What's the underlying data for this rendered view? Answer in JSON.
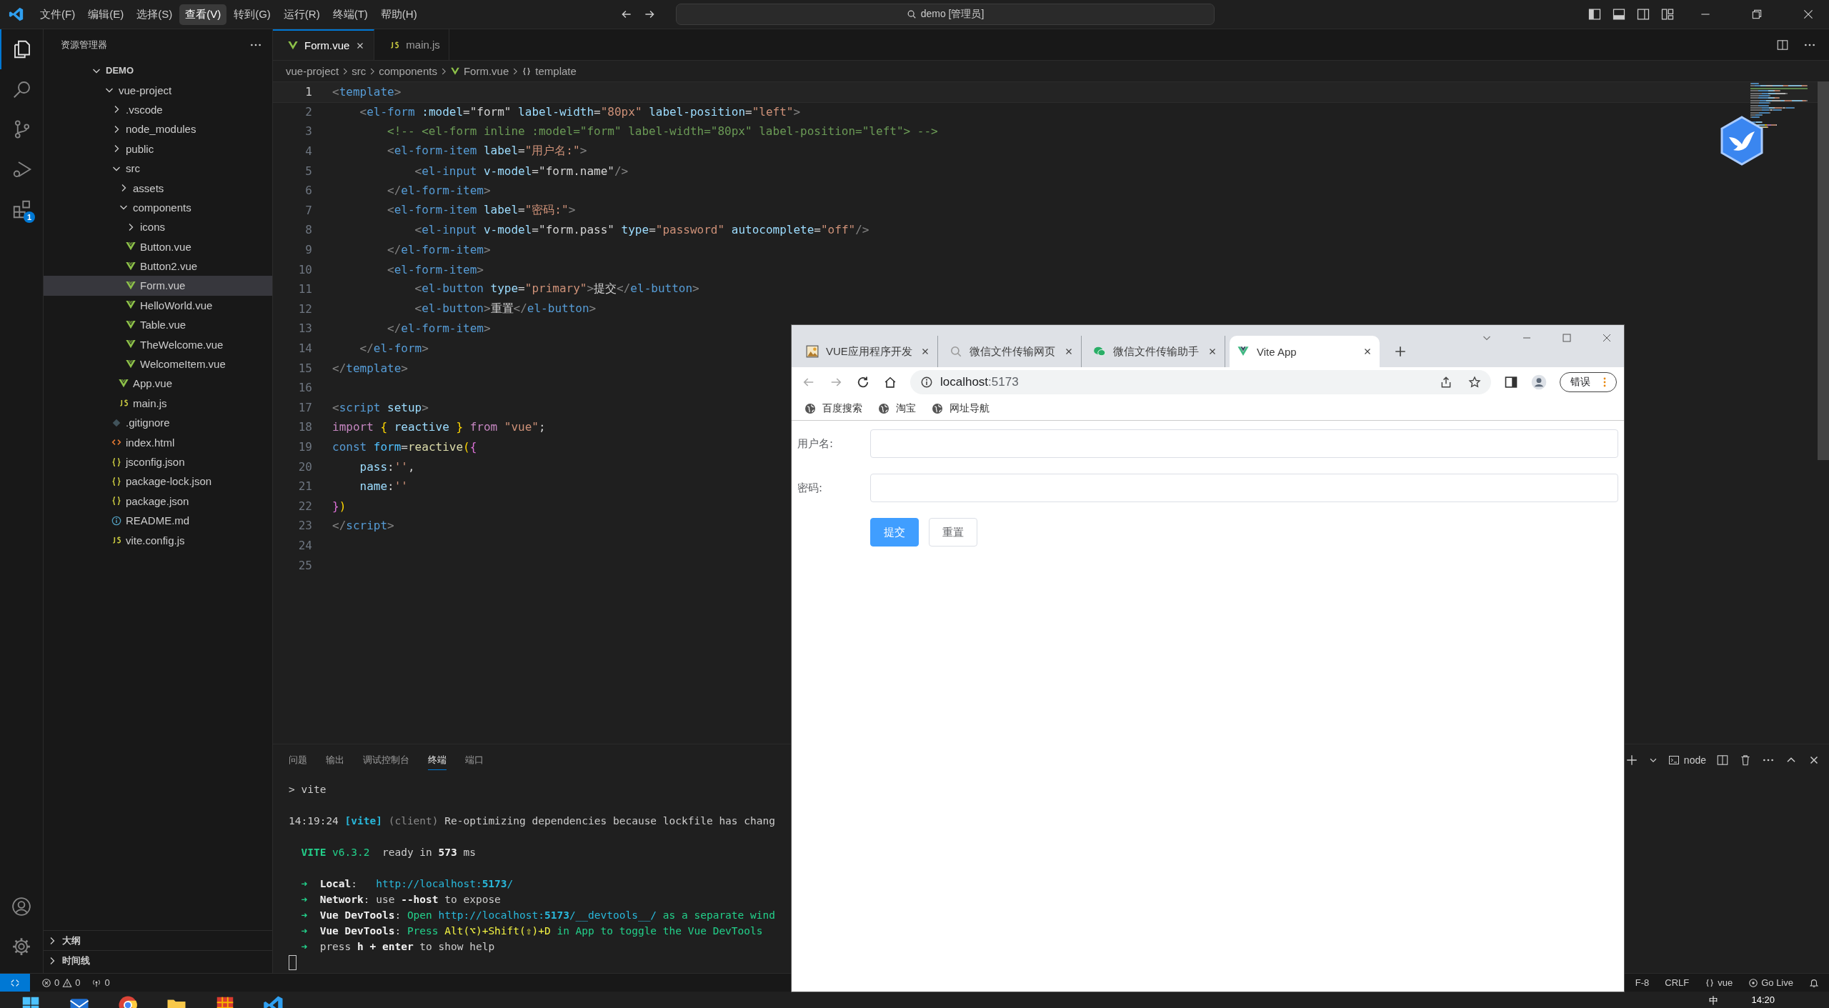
{
  "title_bar": {
    "menu": [
      {
        "label": "文件(F)",
        "selected": false
      },
      {
        "label": "编辑(E)",
        "selected": false
      },
      {
        "label": "选择(S)",
        "selected": false
      },
      {
        "label": "查看(V)",
        "selected": true
      },
      {
        "label": "转到(G)",
        "selected": false
      },
      {
        "label": "运行(R)",
        "selected": false
      },
      {
        "label": "终端(T)",
        "selected": false
      },
      {
        "label": "帮助(H)",
        "selected": false
      }
    ],
    "search": "demo [管理员]"
  },
  "activity_bar": {
    "items": [
      {
        "kind": "explorer",
        "selected": true
      },
      {
        "kind": "search",
        "selected": false
      },
      {
        "kind": "source-control",
        "selected": false
      },
      {
        "kind": "run-debug",
        "selected": false
      },
      {
        "kind": "extensions",
        "selected": false,
        "badge": "1"
      }
    ],
    "bottom": [
      {
        "kind": "account"
      },
      {
        "kind": "settings"
      }
    ]
  },
  "sidebar": {
    "title": "资源管理器",
    "tree": [
      {
        "label": "DEMO",
        "kind": "workspace",
        "expanded": true,
        "selected": false,
        "children": [
          {
            "label": "vue-project",
            "kind": "folder",
            "expanded": true,
            "selected": false,
            "children": [
              {
                "label": ".vscode",
                "kind": "folder",
                "expanded": false,
                "selected": false
              },
              {
                "label": "node_modules",
                "kind": "folder",
                "expanded": false,
                "selected": false
              },
              {
                "label": "public",
                "kind": "folder",
                "expanded": false,
                "selected": false
              },
              {
                "label": "src",
                "kind": "folder",
                "expanded": true,
                "selected": false,
                "children": [
                  {
                    "label": "assets",
                    "kind": "folder",
                    "expanded": false,
                    "selected": false
                  },
                  {
                    "label": "components",
                    "kind": "folder",
                    "expanded": true,
                    "selected": false,
                    "children": [
                      {
                        "label": "icons",
                        "kind": "folder",
                        "expanded": false,
                        "selected": false
                      },
                      {
                        "label": "Button.vue",
                        "kind": "vue",
                        "selected": false
                      },
                      {
                        "label": "Button2.vue",
                        "kind": "vue",
                        "selected": false
                      },
                      {
                        "label": "Form.vue",
                        "kind": "vue",
                        "selected": true
                      },
                      {
                        "label": "HelloWorld.vue",
                        "kind": "vue",
                        "selected": false
                      },
                      {
                        "label": "Table.vue",
                        "kind": "vue",
                        "selected": false
                      },
                      {
                        "label": "TheWelcome.vue",
                        "kind": "vue",
                        "selected": false
                      },
                      {
                        "label": "WelcomeItem.vue",
                        "kind": "vue",
                        "selected": false
                      }
                    ]
                  },
                  {
                    "label": "App.vue",
                    "kind": "vue",
                    "selected": false
                  },
                  {
                    "label": "main.js",
                    "kind": "js",
                    "selected": false
                  }
                ]
              },
              {
                "label": ".gitignore",
                "kind": "git",
                "selected": false
              },
              {
                "label": "index.html",
                "kind": "html",
                "selected": false
              },
              {
                "label": "jsconfig.json",
                "kind": "json",
                "selected": false
              },
              {
                "label": "package-lock.json",
                "kind": "json",
                "selected": false
              },
              {
                "label": "package.json",
                "kind": "json",
                "selected": false
              },
              {
                "label": "README.md",
                "kind": "info",
                "selected": false
              },
              {
                "label": "vite.config.js",
                "kind": "js",
                "selected": false
              }
            ]
          }
        ]
      }
    ],
    "sections": [
      {
        "label": "大纲",
        "expanded": false
      },
      {
        "label": "时间线",
        "expanded": false
      }
    ]
  },
  "editor": {
    "tabs": [
      {
        "label": "Form.vue",
        "kind": "vue",
        "selected": true
      },
      {
        "label": "main.js",
        "kind": "js",
        "selected": false
      }
    ],
    "breadcrumb": [
      {
        "label": "vue-project",
        "kind": "folder"
      },
      {
        "label": "src",
        "kind": "folder"
      },
      {
        "label": "components",
        "kind": "folder"
      },
      {
        "label": "Form.vue",
        "kind": "vue"
      },
      {
        "label": "template",
        "kind": "symbol"
      }
    ],
    "lines": [
      {
        "num": "1",
        "tokens": [
          {
            "t": "<",
            "kind": "p"
          },
          {
            "t": "template",
            "kind": "tag"
          },
          {
            "t": ">",
            "kind": "p"
          }
        ]
      },
      {
        "num": "2",
        "tokens": [
          {
            "t": "    <",
            "kind": "p"
          },
          {
            "t": "el-form",
            "kind": "tag"
          },
          {
            "t": " :model",
            "kind": "attr"
          },
          {
            "t": "=",
            "kind": "tx"
          },
          {
            "t": "\"form\"",
            "kind": "tx"
          },
          {
            "t": " label-width",
            "kind": "attr"
          },
          {
            "t": "=",
            "kind": "tx"
          },
          {
            "t": "\"80px\"",
            "kind": "str"
          },
          {
            "t": " label-position",
            "kind": "attr"
          },
          {
            "t": "=",
            "kind": "tx"
          },
          {
            "t": "\"left\"",
            "kind": "str"
          },
          {
            "t": ">",
            "kind": "p"
          }
        ]
      },
      {
        "num": "3",
        "tokens": [
          {
            "t": "        <!-- <el-form inline :model=\"form\" label-width=\"80px\" label-position=\"left\"> -->",
            "kind": "cm"
          }
        ]
      },
      {
        "num": "4",
        "tokens": [
          {
            "t": "        <",
            "kind": "p"
          },
          {
            "t": "el-form-item",
            "kind": "tag"
          },
          {
            "t": " label",
            "kind": "attr"
          },
          {
            "t": "=",
            "kind": "tx"
          },
          {
            "t": "\"用户名:\"",
            "kind": "str"
          },
          {
            "t": ">",
            "kind": "p"
          }
        ]
      },
      {
        "num": "5",
        "tokens": [
          {
            "t": "            <",
            "kind": "p"
          },
          {
            "t": "el-input",
            "kind": "tag"
          },
          {
            "t": " v-model",
            "kind": "attr"
          },
          {
            "t": "=",
            "kind": "tx"
          },
          {
            "t": "\"form.name\"",
            "kind": "tx"
          },
          {
            "t": "/>",
            "kind": "p"
          }
        ]
      },
      {
        "num": "6",
        "tokens": [
          {
            "t": "        </",
            "kind": "p"
          },
          {
            "t": "el-form-item",
            "kind": "tag"
          },
          {
            "t": ">",
            "kind": "p"
          }
        ]
      },
      {
        "num": "7",
        "tokens": [
          {
            "t": "        <",
            "kind": "p"
          },
          {
            "t": "el-form-item",
            "kind": "tag"
          },
          {
            "t": " label",
            "kind": "attr"
          },
          {
            "t": "=",
            "kind": "tx"
          },
          {
            "t": "\"密码:\"",
            "kind": "str"
          },
          {
            "t": ">",
            "kind": "p"
          }
        ]
      },
      {
        "num": "8",
        "tokens": [
          {
            "t": "            <",
            "kind": "p"
          },
          {
            "t": "el-input",
            "kind": "tag"
          },
          {
            "t": " v-model",
            "kind": "attr"
          },
          {
            "t": "=",
            "kind": "tx"
          },
          {
            "t": "\"form.pass\"",
            "kind": "tx"
          },
          {
            "t": " type",
            "kind": "attr"
          },
          {
            "t": "=",
            "kind": "tx"
          },
          {
            "t": "\"password\"",
            "kind": "str"
          },
          {
            "t": " autocomplete",
            "kind": "attr"
          },
          {
            "t": "=",
            "kind": "tx"
          },
          {
            "t": "\"off\"",
            "kind": "str"
          },
          {
            "t": "/>",
            "kind": "p"
          }
        ]
      },
      {
        "num": "9",
        "tokens": [
          {
            "t": "        </",
            "kind": "p"
          },
          {
            "t": "el-form-item",
            "kind": "tag"
          },
          {
            "t": ">",
            "kind": "p"
          }
        ]
      },
      {
        "num": "10",
        "tokens": [
          {
            "t": "        <",
            "kind": "p"
          },
          {
            "t": "el-form-item",
            "kind": "tag"
          },
          {
            "t": ">",
            "kind": "p"
          }
        ]
      },
      {
        "num": "11",
        "tokens": [
          {
            "t": "            <",
            "kind": "p"
          },
          {
            "t": "el-button",
            "kind": "tag"
          },
          {
            "t": " type",
            "kind": "attr"
          },
          {
            "t": "=",
            "kind": "tx"
          },
          {
            "t": "\"primary\"",
            "kind": "str"
          },
          {
            "t": ">",
            "kind": "p"
          },
          {
            "t": "提交",
            "kind": "tx"
          },
          {
            "t": "</",
            "kind": "p"
          },
          {
            "t": "el-button",
            "kind": "tag"
          },
          {
            "t": ">",
            "kind": "p"
          }
        ]
      },
      {
        "num": "12",
        "tokens": [
          {
            "t": "            <",
            "kind": "p"
          },
          {
            "t": "el-button",
            "kind": "tag"
          },
          {
            "t": ">",
            "kind": "p"
          },
          {
            "t": "重置",
            "kind": "tx"
          },
          {
            "t": "</",
            "kind": "p"
          },
          {
            "t": "el-button",
            "kind": "tag"
          },
          {
            "t": ">",
            "kind": "p"
          }
        ]
      },
      {
        "num": "13",
        "tokens": [
          {
            "t": "        </",
            "kind": "p"
          },
          {
            "t": "el-form-item",
            "kind": "tag"
          },
          {
            "t": ">",
            "kind": "p"
          }
        ]
      },
      {
        "num": "14",
        "tokens": [
          {
            "t": "    </",
            "kind": "p"
          },
          {
            "t": "el-form",
            "kind": "tag"
          },
          {
            "t": ">",
            "kind": "p"
          }
        ]
      },
      {
        "num": "15",
        "tokens": [
          {
            "t": "</",
            "kind": "p"
          },
          {
            "t": "template",
            "kind": "tag"
          },
          {
            "t": ">",
            "kind": "p"
          }
        ]
      },
      {
        "num": "16"
      },
      {
        "num": "17",
        "tokens": [
          {
            "t": "<",
            "kind": "p"
          },
          {
            "t": "script",
            "kind": "tag"
          },
          {
            "t": " setup",
            "kind": "attr"
          },
          {
            "t": ">",
            "kind": "p"
          }
        ]
      },
      {
        "num": "18",
        "tokens": [
          {
            "t": "import",
            "kind": "kw"
          },
          {
            "t": " {",
            "kind": "b1"
          },
          {
            "t": " reactive",
            "kind": "attr"
          },
          {
            "t": " }",
            "kind": "b1"
          },
          {
            "t": " from",
            "kind": "kw"
          },
          {
            "t": " \"vue\"",
            "kind": "str"
          },
          {
            "t": ";",
            "kind": "tx"
          }
        ]
      },
      {
        "num": "19",
        "tokens": [
          {
            "t": "const",
            "kind": "tag"
          },
          {
            "t": " form",
            "kind": "var"
          },
          {
            "t": "=",
            "kind": "tx"
          },
          {
            "t": "reactive",
            "kind": "fn"
          },
          {
            "t": "(",
            "kind": "b1"
          },
          {
            "t": "{",
            "kind": "b2"
          }
        ]
      },
      {
        "num": "20",
        "tokens": [
          {
            "t": "    pass",
            "kind": "attr"
          },
          {
            "t": ":",
            "kind": "tx"
          },
          {
            "t": "''",
            "kind": "str"
          },
          {
            "t": ",",
            "kind": "tx"
          }
        ]
      },
      {
        "num": "21",
        "tokens": [
          {
            "t": "    name",
            "kind": "attr"
          },
          {
            "t": ":",
            "kind": "tx"
          },
          {
            "t": "''",
            "kind": "str"
          }
        ]
      },
      {
        "num": "22",
        "tokens": [
          {
            "t": "}",
            "kind": "b2"
          },
          {
            "t": ")",
            "kind": "b1"
          }
        ]
      },
      {
        "num": "23",
        "tokens": [
          {
            "t": "</",
            "kind": "p"
          },
          {
            "t": "script",
            "kind": "tag"
          },
          {
            "t": ">",
            "kind": "p"
          }
        ]
      },
      {
        "num": "24"
      },
      {
        "num": "25"
      }
    ]
  },
  "panel": {
    "tabs": [
      {
        "label": "问题",
        "selected": false
      },
      {
        "label": "输出",
        "selected": false
      },
      {
        "label": "调试控制台",
        "selected": false
      },
      {
        "label": "终端",
        "selected": true
      },
      {
        "label": "端口",
        "selected": false
      }
    ],
    "shell": "node",
    "terminal": [
      {
        "lines": [
          {
            "segments": [
              {
                "t": "> vite",
                "kind": "plain"
              }
            ]
          }
        ]
      },
      {
        "lines": [
          {
            "segments": [
              {
                "t": "14:19:24 ",
                "kind": "plain"
              },
              {
                "t": "[vite]",
                "kind": "cyanbold"
              },
              {
                "t": " (client)",
                "kind": "dim"
              },
              {
                "t": " Re-optimizing dependencies because lockfile has chang",
                "kind": "plain"
              }
            ]
          }
        ]
      },
      {
        "lines": [
          {
            "segments": [
              {
                "t": "  VITE",
                "kind": "greenbold"
              },
              {
                "t": " v6.3.2",
                "kind": "green"
              },
              {
                "t": "  ready in ",
                "kind": "plain"
              },
              {
                "t": "573",
                "kind": "bold"
              },
              {
                "t": " ms",
                "kind": "plain"
              }
            ]
          }
        ]
      },
      {
        "lines": [
          {
            "segments": [
              {
                "t": "  ➜  ",
                "kind": "greenbold"
              },
              {
                "t": "Local",
                "kind": "bold"
              },
              {
                "t": ":   ",
                "kind": "plain"
              },
              {
                "t": "http://localhost:",
                "kind": "cyan"
              },
              {
                "t": "5173",
                "kind": "cyanbold"
              },
              {
                "t": "/",
                "kind": "cyan"
              }
            ]
          },
          {
            "segments": [
              {
                "t": "  ➜  ",
                "kind": "greenbold"
              },
              {
                "t": "Network",
                "kind": "bold"
              },
              {
                "t": ": use ",
                "kind": "plain"
              },
              {
                "t": "--host",
                "kind": "bold"
              },
              {
                "t": " to expose",
                "kind": "plain"
              }
            ]
          },
          {
            "segments": [
              {
                "t": "  ➜  ",
                "kind": "greenbold"
              },
              {
                "t": "Vue DevTools",
                "kind": "bold"
              },
              {
                "t": ": ",
                "kind": "plain"
              },
              {
                "t": "Open ",
                "kind": "green"
              },
              {
                "t": "http://localhost:",
                "kind": "cyan"
              },
              {
                "t": "5173",
                "kind": "cyanbold"
              },
              {
                "t": "/__devtools__/",
                "kind": "cyan"
              },
              {
                "t": " as a separate wind",
                "kind": "green"
              }
            ]
          },
          {
            "segments": [
              {
                "t": "  ➜  ",
                "kind": "greenbold"
              },
              {
                "t": "Vue DevTools",
                "kind": "bold"
              },
              {
                "t": ": ",
                "kind": "plain"
              },
              {
                "t": "Press ",
                "kind": "green"
              },
              {
                "t": "Alt(⌥)+Shift(⇧)+D",
                "kind": "yellow"
              },
              {
                "t": " in App to toggle the Vue DevTools",
                "kind": "green"
              }
            ]
          },
          {
            "segments": [
              {
                "t": "  ➜  ",
                "kind": "greenbold"
              },
              {
                "t": "press ",
                "kind": "plain"
              },
              {
                "t": "h + enter",
                "kind": "bold"
              },
              {
                "t": " to show help",
                "kind": "plain"
              }
            ]
          }
        ]
      }
    ]
  },
  "status_bar": {
    "errors": "0",
    "warnings": "0",
    "ports": "0",
    "right": [
      {
        "label": "F-8",
        "kind": "text"
      },
      {
        "label": "CRLF",
        "kind": "text"
      },
      {
        "label": "vue",
        "kind": "language"
      },
      {
        "label": "Go Live",
        "kind": "live"
      }
    ]
  },
  "taskbar": {
    "apps": [
      {
        "kind": "start"
      },
      {
        "kind": "mail"
      },
      {
        "kind": "chrome"
      },
      {
        "kind": "folder"
      },
      {
        "kind": "grid"
      },
      {
        "kind": "vscode"
      }
    ],
    "ime": "中",
    "time": "14:20"
  },
  "browser": {
    "tabs": [
      {
        "title": "VUE应用程序开发",
        "kind": "picture",
        "selected": false
      },
      {
        "title": "微信文件传输网页",
        "kind": "search",
        "selected": false
      },
      {
        "title": "微信文件传输助手",
        "kind": "wechat",
        "selected": false
      },
      {
        "title": "Vite App",
        "kind": "vue",
        "selected": true
      }
    ],
    "address": {
      "host": "localhost",
      "port": ":5173"
    },
    "error_button": "错误",
    "bookmarks": [
      "百度搜索",
      "淘宝",
      "网址导航"
    ],
    "form": {
      "fields": [
        {
          "label": "用户名:"
        },
        {
          "label": "密码:"
        }
      ],
      "buttons": [
        {
          "label": "提交",
          "kind": "primary"
        },
        {
          "label": "重置",
          "kind": "default"
        }
      ]
    }
  }
}
